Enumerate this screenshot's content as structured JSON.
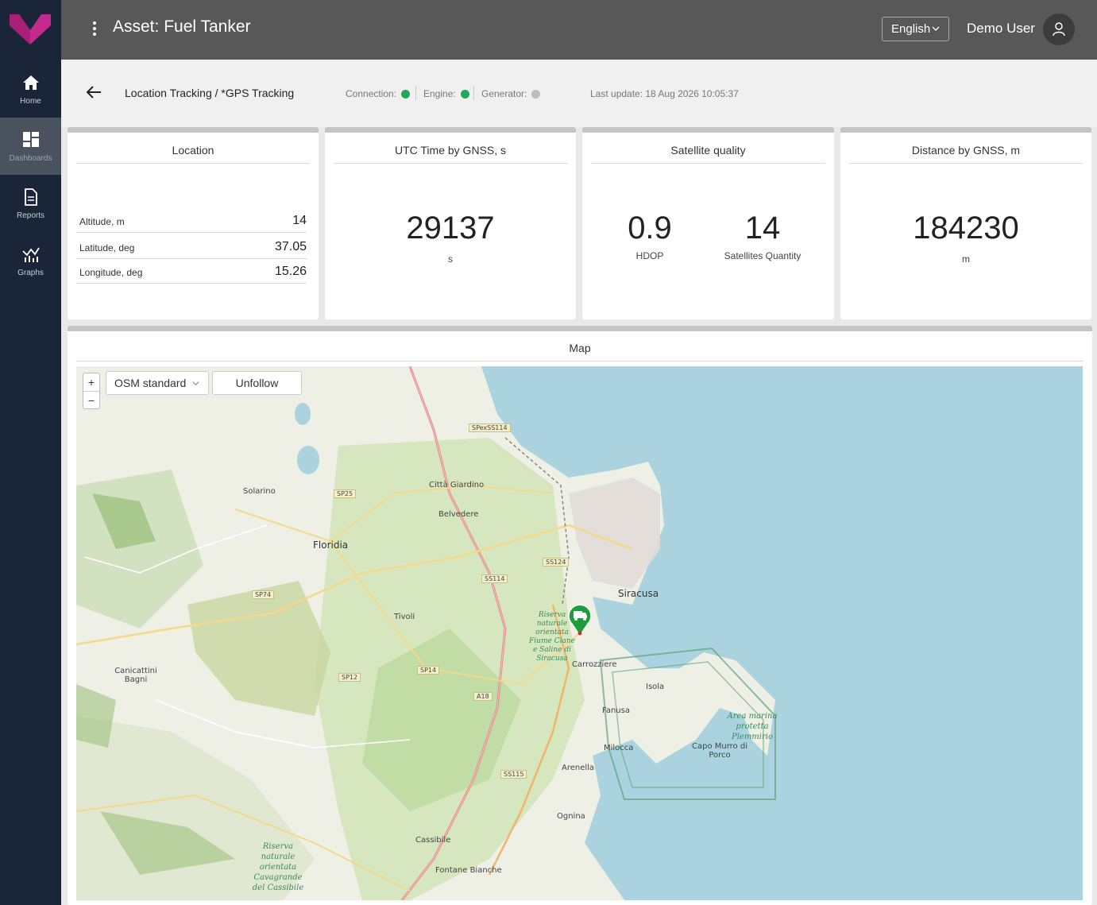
{
  "colors": {
    "sidebar": "#1b2538",
    "header": "#585858",
    "accent": "#c42a8e",
    "status_on": "#22a85a",
    "status_off": "#bdbdbd"
  },
  "sidebar": {
    "items": [
      {
        "label": "Home",
        "icon": "home-icon"
      },
      {
        "label": "Dashboards",
        "icon": "dashboard-icon",
        "active": true
      },
      {
        "label": "Reports",
        "icon": "document-icon"
      },
      {
        "label": "Graphs",
        "icon": "graph-icon"
      }
    ]
  },
  "header": {
    "title": "Asset: Fuel Tanker",
    "language": "English",
    "user_name": "Demo User"
  },
  "subheader": {
    "breadcrumb": "Location Tracking / *GPS Tracking",
    "connection_label": "Connection:",
    "engine_label": "Engine:",
    "generator_label": "Generator:",
    "connection_status": "on",
    "engine_status": "on",
    "generator_status": "off",
    "last_update": "Last update: 18 Aug 2026 10:05:37"
  },
  "cards": {
    "location": {
      "title": "Location",
      "rows": [
        {
          "label": "Altitude, m",
          "value": "14"
        },
        {
          "label": "Latitude, deg",
          "value": "37.05"
        },
        {
          "label": "Longitude, deg",
          "value": "15.26"
        }
      ]
    },
    "utc": {
      "title": "UTC Time by GNSS, s",
      "value": "29137",
      "unit": "s"
    },
    "satellite": {
      "title": "Satellite quality",
      "hdop_value": "0.9",
      "hdop_label": "HDOP",
      "sat_value": "14",
      "sat_label": "Satellites Quantity"
    },
    "distance": {
      "title": "Distance by GNSS, m",
      "value": "184230",
      "unit": "m"
    }
  },
  "map": {
    "title": "Map",
    "zoom_in": "+",
    "zoom_out": "−",
    "layer": "OSM standard",
    "unfollow": "Unfollow",
    "places": {
      "solarino": "Solarino",
      "floridia": "Floridia",
      "citta_giardino": "Città Giardino",
      "belvedere": "Belvedere",
      "siracusa": "Siracusa",
      "tivoli": "Tivoli",
      "canicattini": "Canicattini Bagni",
      "carrozziere": "Carrozziere",
      "isola": "Isola",
      "fanusa": "Fanusa",
      "milocca": "Milocca",
      "arenella": "Arenella",
      "ognina": "Ognina",
      "cassibile": "Cassibile",
      "fontane_bianche": "Fontane Bianche",
      "capo_murro": "Capo Murro di Porco"
    },
    "roads": {
      "spexss114": "SPexSS114",
      "sp25": "SP25",
      "ss124": "SS124",
      "ss114": "SS114",
      "sp74": "SP74",
      "sp14": "SP14",
      "sp12": "SP12",
      "a18": "A18",
      "ss115": "SS115"
    },
    "areas": {
      "plemmirio": "Area marina protetta Plemmirio",
      "ciane": "Riserva naturale orientata Fiume Ciane e Saline di Siracusa",
      "cavagrande": "Riserva naturale orientata Cavagrande del Cassibile"
    }
  }
}
